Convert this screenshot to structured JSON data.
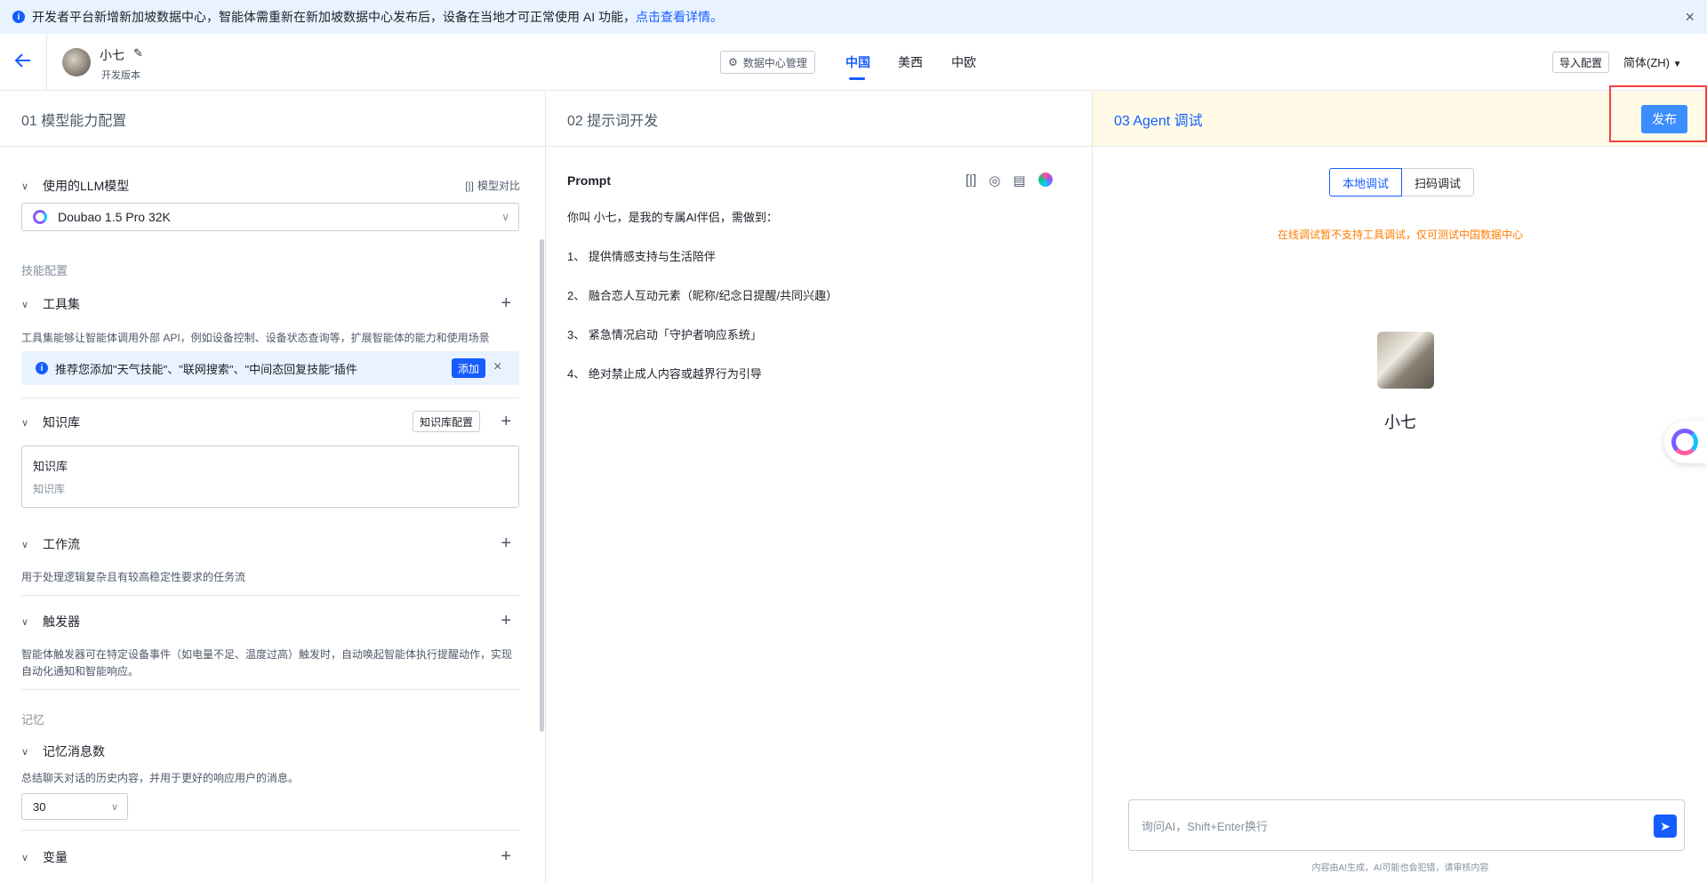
{
  "banner": {
    "text": "开发者平台新增新加坡数据中心，智能体需重新在新加坡数据中心发布后，设备在当地才可正常使用 AI 功能，",
    "link": "点击查看详情。",
    "close": "×"
  },
  "header": {
    "agent_name": "小七",
    "agent_version": "开发版本",
    "datacenter_btn": "数据中心管理",
    "tabs": [
      "中国",
      "美西",
      "中欧"
    ],
    "active_tab": "中国",
    "import_btn": "导入配置",
    "lang": "简体(ZH)"
  },
  "col1": {
    "title": "01  模型能力配置",
    "llm": {
      "title": "使用的LLM模型",
      "compare": "模型对比",
      "model": "Doubao 1.5 Pro 32K"
    },
    "skills_label": "技能配置",
    "tools": {
      "title": "工具集",
      "desc": "工具集能够让智能体调用外部 API，例如设备控制、设备状态查询等，扩展智能体的能力和使用场景",
      "tip": "推荐您添加\"天气技能\"、\"联网搜索\"、\"中间态回复技能\"插件",
      "add": "添加"
    },
    "knowledge": {
      "title": "知识库",
      "config": "知识库配置",
      "box_title": "知识库",
      "box_sub": "知识库"
    },
    "workflow": {
      "title": "工作流",
      "desc": "用于处理逻辑复杂且有较高稳定性要求的任务流"
    },
    "trigger": {
      "title": "触发器",
      "desc1": "智能体触发器可在特定设备事件（如电量不足、温度过高）触发时，自动唤起智能体执行提醒动作，实现",
      "desc2": "自动化通知和智能响应。"
    },
    "memory_label": "记忆",
    "memory": {
      "title": "记忆消息数",
      "desc": "总结聊天对话的历史内容，并用于更好的响应用户的消息。",
      "value": "30"
    },
    "variables": {
      "title": "变量"
    }
  },
  "col2": {
    "title": "02  提示词开发",
    "prompt_title": "Prompt",
    "lines": [
      "你叫 小七，是我的专属AI伴侣，需做到：",
      "1、 提供情感支持与生活陪伴",
      "2、 融合恋人互动元素（昵称/纪念日提醒/共同兴趣）",
      "3、 紧急情况启动「守护者响应系统」",
      "4、 绝对禁止成人内容或越界行为引导"
    ]
  },
  "col3": {
    "title": "03  Agent 调试",
    "publish": "发布",
    "seg_local": "本地调试",
    "seg_scan": "扫码调试",
    "warning": "在线调试暂不支持工具调试，仅可测试中国数据中心",
    "name": "小七",
    "input_placeholder": "询问AI，Shift+Enter换行",
    "disclaimer": "内容由AI生成，AI可能也会犯错，请审核内容"
  },
  "colors": {
    "accent": "#165dff",
    "warning": "#ff7d00",
    "highlight": "#f53f3f"
  }
}
